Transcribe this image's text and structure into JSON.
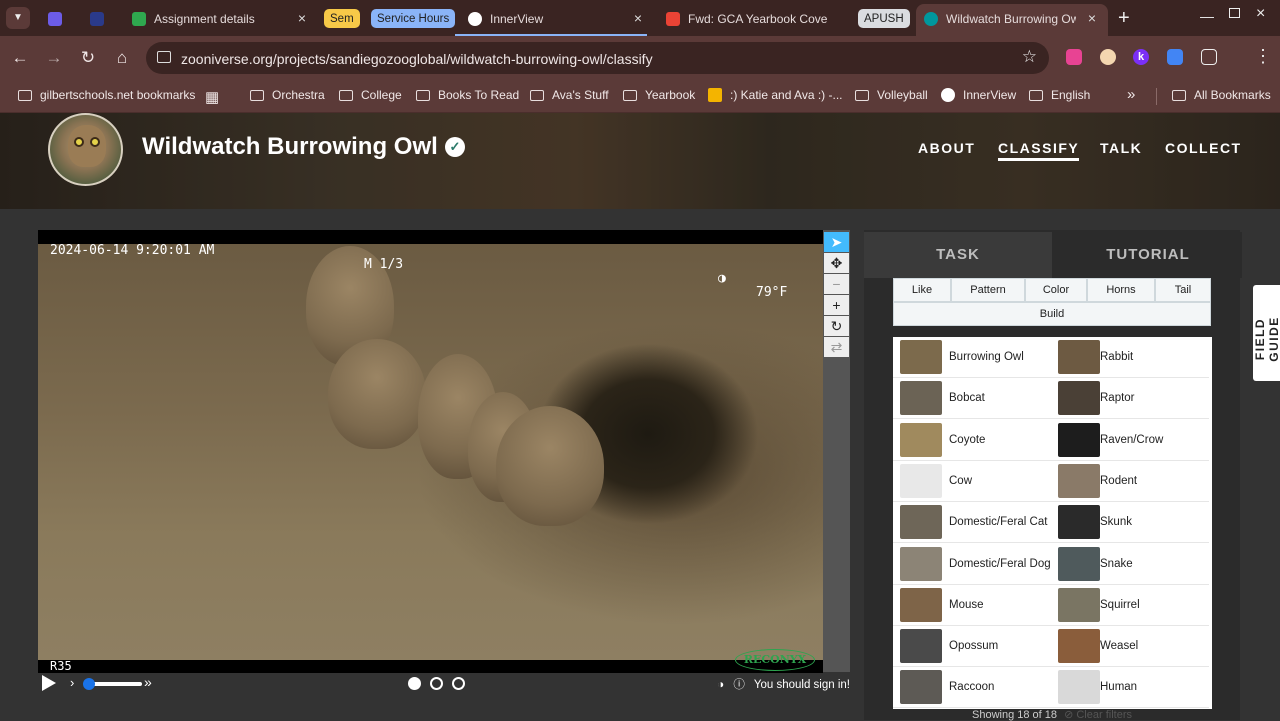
{
  "browser": {
    "tabs": [
      {
        "title": "",
        "favicon_color": "#6c5ce7"
      },
      {
        "title": "",
        "favicon_color": "#2a3a8a"
      },
      {
        "title": "Assignment details",
        "favicon_color": "#2fa84f"
      },
      {
        "title": "Sem",
        "pill_color": "#f7c948"
      },
      {
        "title": "Service Hours",
        "pill_color": "#8ab4f8"
      },
      {
        "title": "InnerView",
        "favicon_color": "#ffffff"
      },
      {
        "title": "Fwd: GCA Yearbook Cove",
        "favicon_color": "#ea4335"
      },
      {
        "title": "APUSH",
        "pill_color": "#dadce0"
      },
      {
        "title": "Wildwatch Burrowing Owl",
        "favicon_color": "#00979d",
        "active": true
      }
    ],
    "new_tab": "+",
    "url": "zooniverse.org/projects/sandiegozooglobal/wildwatch-burrowing-owl/classify",
    "bookmarks": [
      "gilbertschools.net bookmarks",
      "Orchestra",
      "College",
      "Books To Read",
      "Ava's Stuff",
      "Yearbook",
      ":) Katie and Ava :) -...",
      "Volleyball",
      "InnerView",
      "English"
    ],
    "all_bookmarks": "All Bookmarks",
    "overflow": "»"
  },
  "project": {
    "title": "Wildwatch Burrowing Owl",
    "nav": [
      "ABOUT",
      "CLASSIFY",
      "TALK",
      "COLLECT"
    ],
    "active_nav": "CLASSIFY"
  },
  "subject": {
    "stamp_date": "2024-06-14 9:20:01 AM",
    "stamp_frame": "M 1/3",
    "stamp_temp": "79°F",
    "camera_id": "R35",
    "brand": "RECONYX",
    "frames_total": 3,
    "frame_current": 1,
    "signin_text": "You should sign in!"
  },
  "task_panel": {
    "tabs": [
      "TASK",
      "TUTORIAL"
    ],
    "filters": [
      "Like",
      "Pattern",
      "Color",
      "Horns",
      "Tail",
      "Build"
    ],
    "choices": [
      {
        "name": "Burrowing Owl",
        "color": "#7c6a4c"
      },
      {
        "name": "Rabbit",
        "color": "#6d5a42"
      },
      {
        "name": "Bobcat",
        "color": "#6b6355"
      },
      {
        "name": "Raptor",
        "color": "#4a4036"
      },
      {
        "name": "Coyote",
        "color": "#a08a5e"
      },
      {
        "name": "Raven/Crow",
        "color": "#1d1d1d"
      },
      {
        "name": "Cow",
        "color": "#e8e8e8"
      },
      {
        "name": "Rodent",
        "color": "#8a7a68"
      },
      {
        "name": "Domestic/Feral Cat",
        "color": "#6e6658"
      },
      {
        "name": "Skunk",
        "color": "#2a2a2a"
      },
      {
        "name": "Domestic/Feral Dog",
        "color": "#8c8476"
      },
      {
        "name": "Snake",
        "color": "#4f5a5c"
      },
      {
        "name": "Mouse",
        "color": "#7e6448"
      },
      {
        "name": "Squirrel",
        "color": "#7a7563"
      },
      {
        "name": "Opossum",
        "color": "#4a4a4a"
      },
      {
        "name": "Weasel",
        "color": "#8a5d3b"
      },
      {
        "name": "Raccoon",
        "color": "#5d5a55"
      },
      {
        "name": "Human",
        "color": "#d9d9d9"
      }
    ],
    "showing": "Showing 18 of 18",
    "clear_filters": "Clear filters"
  },
  "field_guide": "FIELD GUIDE"
}
